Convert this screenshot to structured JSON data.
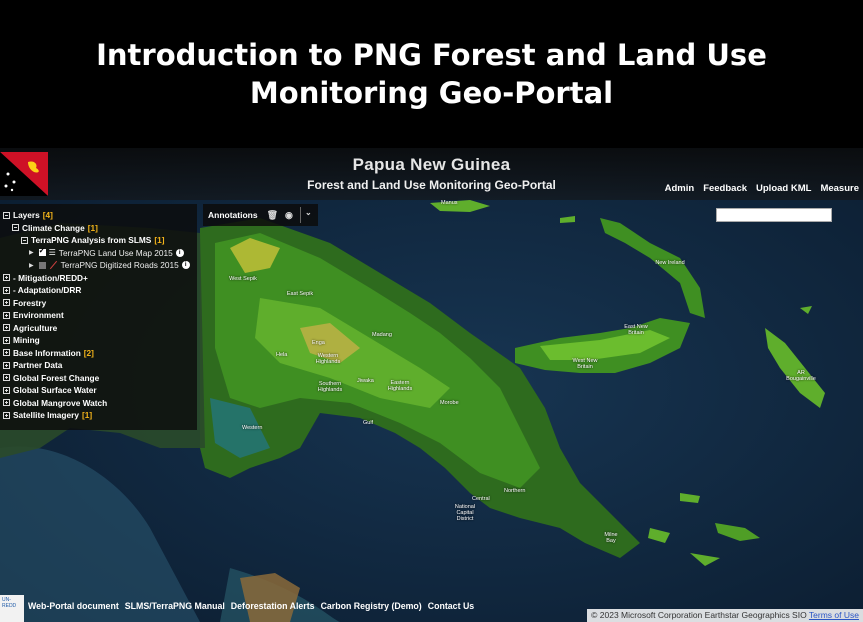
{
  "slide": {
    "title_line1": "Introduction to PNG Forest and Land Use",
    "title_line2": "Monitoring Geo-Portal"
  },
  "header": {
    "title": "Papua New Guinea",
    "subtitle": "Forest and Land Use Monitoring Geo-Portal",
    "links": [
      "Admin",
      "Feedback",
      "Upload KML",
      "Measure"
    ]
  },
  "search": {
    "value": ""
  },
  "layers": {
    "title": "Layers",
    "title_count": "[4]",
    "climate": {
      "label": "Climate Change",
      "count": "[1]"
    },
    "analysis": {
      "label": "TerraPNG Analysis from SLMS",
      "count": "[1]"
    },
    "land_use": {
      "label": "TerraPNG Land Use Map 2015",
      "checked": true
    },
    "roads": {
      "label": "TerraPNG Digitized Roads 2015",
      "checked": false
    },
    "groups": [
      {
        "label": "- Mitigation/REDD+",
        "count": ""
      },
      {
        "label": "- Adaptation/DRR",
        "count": ""
      },
      {
        "label": "Forestry",
        "count": ""
      },
      {
        "label": "Environment",
        "count": ""
      },
      {
        "label": "Agriculture",
        "count": ""
      },
      {
        "label": "Mining",
        "count": ""
      },
      {
        "label": "Base Information",
        "count": "[2]"
      },
      {
        "label": "Partner Data",
        "count": ""
      },
      {
        "label": "Global Forest Change",
        "count": ""
      },
      {
        "label": "Global Surface Water",
        "count": ""
      },
      {
        "label": "Global Mangrove Watch",
        "count": ""
      },
      {
        "label": "Satellite Imagery",
        "count": "[1]"
      }
    ]
  },
  "annotations": {
    "label": "Annotations"
  },
  "footer": {
    "links": [
      "Web-Portal document",
      "SLMS/TerraPNG Manual",
      "Deforestation Alerts",
      "Carbon Registry (Demo)",
      "Contact Us"
    ],
    "attribution": "© 2023 Microsoft Corporation Earthstar Geographics SIO",
    "terms": "Terms of Use",
    "logo_text": "UN-REDD"
  },
  "map_labels": {
    "manus": "Manus",
    "new_ireland": "New Ireland",
    "east_sepik": "East Sepik",
    "west_sepik": "West Sepik",
    "madang": "Madang",
    "enga": "Enga",
    "western_highlands": "Western Highlands",
    "southern_highlands": "Southern Highlands",
    "eastern_highlands": "Eastern Highlands",
    "hela": "Hela",
    "jiwaka": "Jiwaka",
    "western": "Western",
    "gulf": "Gulf",
    "morobe": "Morobe",
    "east_new_britain": "East New Britain",
    "west_new_britain": "West New Britain",
    "bougainville": "AR Bougainville",
    "northern": "Northern",
    "ncd": "National Capital District",
    "central": "Central",
    "milne_bay": "Milne Bay"
  }
}
